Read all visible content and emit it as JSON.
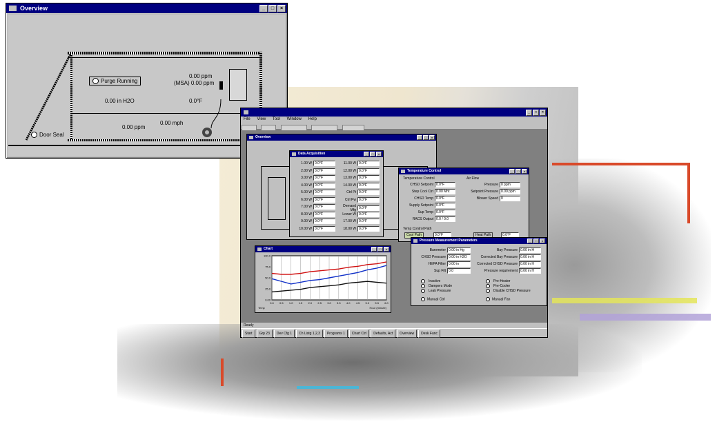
{
  "overview_window": {
    "title": "Overview",
    "purge_label": "Purge Running",
    "ppm_top": "0.00 ppm",
    "msa_ppm": "(MSA) 0.00 ppm",
    "pressure": "0.00 in H2O",
    "temp": "0.0°F",
    "ppm_bottom": "0.00 ppm",
    "mph": "0.00 mph",
    "door_seal": "Door Seal"
  },
  "app": {
    "menu": [
      "File",
      "View",
      "Tool",
      "Window",
      "Help"
    ],
    "status_left": "Ready",
    "taskbar": [
      "Start",
      "Grp 23",
      "Dev Cfg 1",
      "Ch Listg 1,2,3",
      "Programs 1",
      "Chart Ctrl",
      "Defaults, Act",
      "Overview",
      "Desk Func"
    ]
  },
  "sub_overview": {
    "title": "Overview"
  },
  "data_window": {
    "title": "Data Acquisition",
    "left_labels": [
      "1.00 W",
      "2.00 W",
      "3.00 W",
      "4.00 W",
      "5.00 W",
      "6.00 W",
      "7.00 W",
      "8.00 W",
      "9.00 W",
      "10.00 W"
    ],
    "left_values": [
      "0.0°F",
      "0.0°F",
      "0.0°F",
      "0.0°F",
      "0.0°F",
      "0.0°F",
      "0.0°F",
      "0.0°F",
      "0.0°F",
      "0.0°F"
    ],
    "right_labels": [
      "11.00 W",
      "12.00 W",
      "13.00 W",
      "14.00 W",
      "Ctrl Pt",
      "Ctrl Pw",
      "Demand Mfg",
      "Lower W",
      "17.00 W",
      "18.00 W"
    ],
    "right_values": [
      "0.0°F",
      "0.0°F",
      "0.0°F",
      "0.0°F",
      "0.0°F",
      "0.0°F",
      "0.0°F",
      "0.0°F",
      "0.0°F",
      "0.0°F"
    ]
  },
  "control_window": {
    "title": "Temperature Control",
    "group_left": "Temperature Control",
    "left_labels": [
      "CHSD Setpoint",
      "Step Cool Ctrl",
      "CHSD Temp",
      "Supply Setpoint",
      "Sup Temp",
      "RACS Output"
    ],
    "left_values": [
      "0.0°F",
      "0.00 Mnt",
      "0.0°F",
      "0.0°F",
      "0.0°F",
      "0.0 / 0.0"
    ],
    "group_right": "Air Flow",
    "right_labels": [
      "Pressure",
      "Setpoint Pressure",
      "Blower Speed"
    ],
    "right_values": [
      "0 ppm",
      "0.00 ppm",
      "0"
    ],
    "bottom_group": "Temp Control Path",
    "cool_button": "Cool Path",
    "cool_value": "0.0°F",
    "heat_button": "Heat Path",
    "heat_value": "0.0°F"
  },
  "chart_window": {
    "title": "Chart",
    "footer_left": "Temp",
    "footer_right": "Hour (minute)"
  },
  "chart_data": {
    "type": "line",
    "x": [
      "0.0",
      "0.5",
      "1.0",
      "1.5",
      "2.0",
      "2.5",
      "3.0",
      "3.5",
      "4.0",
      "4.5",
      "5.0",
      "5.5",
      "6.0"
    ],
    "ylim": [
      0,
      100
    ],
    "yticks": [
      "0.00",
      "25.0",
      "50.0",
      "75.0",
      "100.0"
    ],
    "series": [
      {
        "values": [
          60,
          58,
          58,
          60,
          64,
          66,
          68,
          70,
          74,
          76,
          80,
          82,
          86
        ],
        "color": "#d01010"
      },
      {
        "values": [
          48,
          42,
          36,
          40,
          44,
          46,
          50,
          54,
          58,
          62,
          68,
          72,
          78
        ],
        "color": "#1030c8"
      },
      {
        "values": [
          18,
          20,
          22,
          24,
          28,
          30,
          32,
          34,
          38,
          40,
          42,
          40,
          38
        ],
        "color": "#101010"
      }
    ]
  },
  "pressure_window": {
    "title": "Pressure Measurement Parameters",
    "left_labels": [
      "Barometer",
      "CHSD Pressure",
      "HEPA Filter",
      "Sup Filt"
    ],
    "left_values": [
      "0.00 in Hg",
      "0.00 in H2O",
      "0.00 in",
      "0.0"
    ],
    "right_labels": [
      "Bay Pressure",
      "Corrected Bay Pressure",
      "Corrected CHSD Pressure",
      "Pressure requirement"
    ],
    "right_values": [
      "0.00 in H",
      "0.00 in H",
      "0.00 in H",
      "0.00 in H"
    ],
    "left_radios": [
      "Inactive",
      "Dampers Mode",
      "Leak Pressure"
    ],
    "right_radios": [
      "Pre-Heater",
      "Pre-Cooler",
      "Disable CHSD Pressure"
    ],
    "bottom_left": "Manual Ctrl",
    "bottom_right": "Manual Fan"
  }
}
